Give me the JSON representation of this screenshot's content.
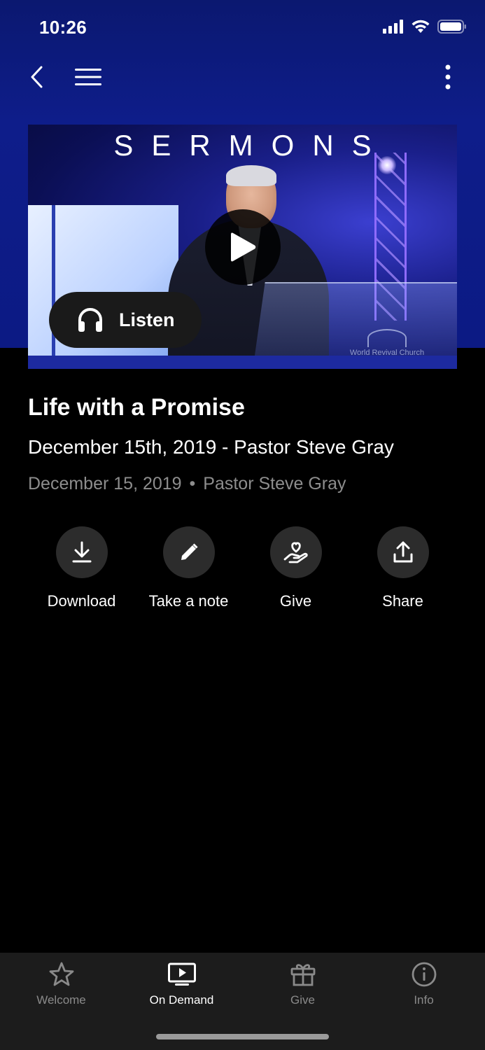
{
  "status_bar": {
    "time": "10:26"
  },
  "media": {
    "banner_text": "SERMONS",
    "church_logo_text": "World Revival Church",
    "listen_label": "Listen"
  },
  "sermon": {
    "title": "Life with a Promise",
    "subtitle": "December 15th, 2019 - Pastor Steve Gray",
    "date": "December 15, 2019",
    "separator": "•",
    "speaker": "Pastor Steve Gray"
  },
  "actions": [
    {
      "label": "Download",
      "icon": "download-icon"
    },
    {
      "label": "Take a note",
      "icon": "pencil-icon"
    },
    {
      "label": "Give",
      "icon": "hand-heart-icon"
    },
    {
      "label": "Share",
      "icon": "share-icon"
    }
  ],
  "tabs": [
    {
      "label": "Welcome",
      "icon": "star-icon",
      "active": false
    },
    {
      "label": "On Demand",
      "icon": "tv-play-icon",
      "active": true
    },
    {
      "label": "Give",
      "icon": "gift-icon",
      "active": false
    },
    {
      "label": "Info",
      "icon": "info-icon",
      "active": false
    }
  ],
  "colors": {
    "hero_blue": "#0e1d8a",
    "background": "#000000",
    "tabbar": "#1c1c1c",
    "inactive_tab": "#8a8a8a"
  }
}
